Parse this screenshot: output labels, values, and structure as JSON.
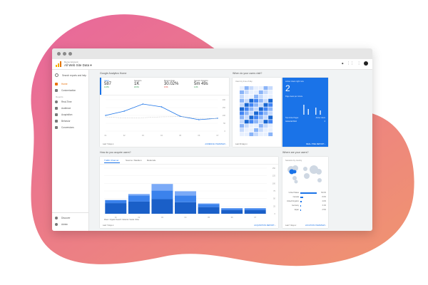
{
  "app": {
    "account_small": "Demo Account",
    "account_title": "All Web Site Data ▾"
  },
  "sidebar": {
    "search_placeholder": "Search reports and help",
    "items": [
      {
        "label": "Home",
        "icon": "home-icon",
        "active": true
      },
      {
        "label": "Customization",
        "icon": "grid-icon"
      }
    ],
    "reports_heading": "Reports",
    "report_items": [
      {
        "label": "Real-Time",
        "icon": "clock-icon"
      },
      {
        "label": "Audience",
        "icon": "person-icon"
      },
      {
        "label": "Acquisition",
        "icon": "acquisition-icon"
      },
      {
        "label": "Behavior",
        "icon": "behavior-icon"
      },
      {
        "label": "Conversions",
        "icon": "flag-icon"
      }
    ],
    "bottom_items": [
      {
        "label": "Discover",
        "icon": "bulb-icon"
      },
      {
        "label": "Admin",
        "icon": "gear-icon"
      }
    ]
  },
  "home_card": {
    "title": "Google Analytics Home",
    "metrics": [
      {
        "label": "Users",
        "value": "587",
        "change": "14.8%"
      },
      {
        "label": "Sessions",
        "value": "1K",
        "change": "18.0%"
      },
      {
        "label": "Bounce Rate",
        "value": "30.02%",
        "change": "9.3%"
      },
      {
        "label": "Session Duration",
        "value": "5m 49s",
        "change": "4.0%"
      }
    ],
    "footer_left": "Last 7 days ▾",
    "footer_right": "AUDIENCE OVERVIEW ›",
    "chart_data": {
      "type": "line",
      "x": [
        "01",
        "02",
        "03",
        "04",
        "05",
        "06",
        "07"
      ],
      "series": [
        {
          "values": [
            55,
            70,
            95,
            85,
            52,
            40,
            45
          ]
        },
        {
          "values": [
            50,
            46,
            47,
            50,
            51,
            45,
            44
          ]
        }
      ],
      "y_ticks": [
        "200",
        "150",
        "100",
        "50",
        "0"
      ]
    }
  },
  "when_card": {
    "title": "When do your users visit?",
    "subtitle": "Users by time of day",
    "footer_left": "Last 30 days ▾"
  },
  "realtime_card": {
    "heading": "Active Users right now",
    "value": "2",
    "subheading": "Page views per minute",
    "top_pages_label": "Top Active Pages",
    "top_pages_value": "Active Users",
    "page_name": "/store/cart.html",
    "page_count": "2",
    "footer_right": "REAL-TIME REPORT ›"
  },
  "acquire_card": {
    "title": "How do you acquire users?",
    "tabs": [
      "Traffic Channel",
      "Source / Medium",
      "Referrals"
    ],
    "footer_left": "Last 7 days ▾",
    "footer_right": "ACQUISITION REPORT ›",
    "legend": [
      "Direct",
      "Organic Search",
      "Referral",
      "Social",
      "Other"
    ],
    "chart_data": {
      "type": "bar",
      "categories": [
        "01",
        "02",
        "03",
        "04",
        "05",
        "06",
        "07"
      ],
      "series": [
        {
          "values": [
            35,
            40,
            48,
            38,
            22,
            12,
            12
          ]
        },
        {
          "values": [
            10,
            20,
            28,
            22,
            10,
            6,
            6
          ]
        },
        {
          "values": [
            0,
            5,
            22,
            14,
            2,
            0,
            0
          ]
        }
      ],
      "y_ticks": [
        "150",
        "125",
        "100",
        "75",
        "50",
        "25",
        "0"
      ],
      "ylim": [
        0,
        150
      ]
    }
  },
  "where_card": {
    "title": "Where are your users?",
    "subtitle": "Sessions by country",
    "countries": [
      {
        "name": "United States",
        "value": "52.0%",
        "fill": 0.52
      },
      {
        "name": "Canada",
        "value": "8.6%",
        "fill": 0.09
      },
      {
        "name": "United Kingdom",
        "value": "4.0%",
        "fill": 0.04
      },
      {
        "name": "Germany",
        "value": "3.1%",
        "fill": 0.03
      },
      {
        "name": "Japan",
        "value": "2.5%",
        "fill": 0.025
      }
    ],
    "footer_left": "Last 7 days ▾",
    "footer_right": "LOCATION OVERVIEW ›"
  },
  "colors": {
    "accent": "#1a73e8",
    "active": "#e8710a",
    "blob_pink": "#e8679c",
    "blob_orange": "#f0956f"
  }
}
